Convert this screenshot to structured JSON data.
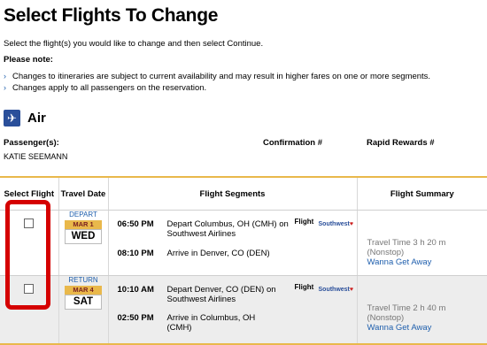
{
  "page": {
    "title": "Select Flights To Change",
    "intro": "Select the flight(s) you would like to change and then select Continue.",
    "note_label": "Please note:",
    "notes": [
      "Changes to itineraries are subject to current availability and may result in higher fares on one or more segments.",
      "Changes apply to all passengers on the reservation."
    ]
  },
  "air": {
    "label": "Air",
    "icon": "airplane-icon"
  },
  "info": {
    "passenger_label": "Passenger(s):",
    "passenger_name": "KATIE SEEMANN",
    "confirmation_label": "Confirmation #",
    "rapid_label": "Rapid Rewards #"
  },
  "table": {
    "headers": {
      "select": "Select Flight",
      "travel_date": "Travel Date",
      "segments": "Flight Segments",
      "summary": "Flight Summary"
    },
    "rows": [
      {
        "type": "DEPART",
        "month": "MAR 1",
        "day": "WED",
        "dep_time": "06:50 PM",
        "dep_text": "Depart Columbus, OH (CMH) on Southwest Airlines",
        "arr_time": "08:10 PM",
        "arr_text": "Arrive in Denver, CO (DEN)",
        "flight_label": "Flight",
        "airline_logo": "Southwest",
        "travel_time": "Travel Time 3 h 20 m",
        "stops": "(Nonstop)",
        "fare": "Wanna Get Away"
      },
      {
        "type": "RETURN",
        "month": "MAR 4",
        "day": "SAT",
        "dep_time": "10:10 AM",
        "dep_text": "Depart Denver, CO (DEN) on Southwest Airlines",
        "arr_time": "02:50 PM",
        "arr_text": "Arrive in Columbus, OH (CMH)",
        "flight_label": "Flight",
        "airline_logo": "Southwest",
        "travel_time": "Travel Time 2 h 40 m",
        "stops": "(Nonstop)",
        "fare": "Wanna Get Away"
      }
    ]
  },
  "colors": {
    "accent_gold": "#e9b84b",
    "link_blue": "#1f5fad",
    "highlight_red": "#d50000"
  }
}
